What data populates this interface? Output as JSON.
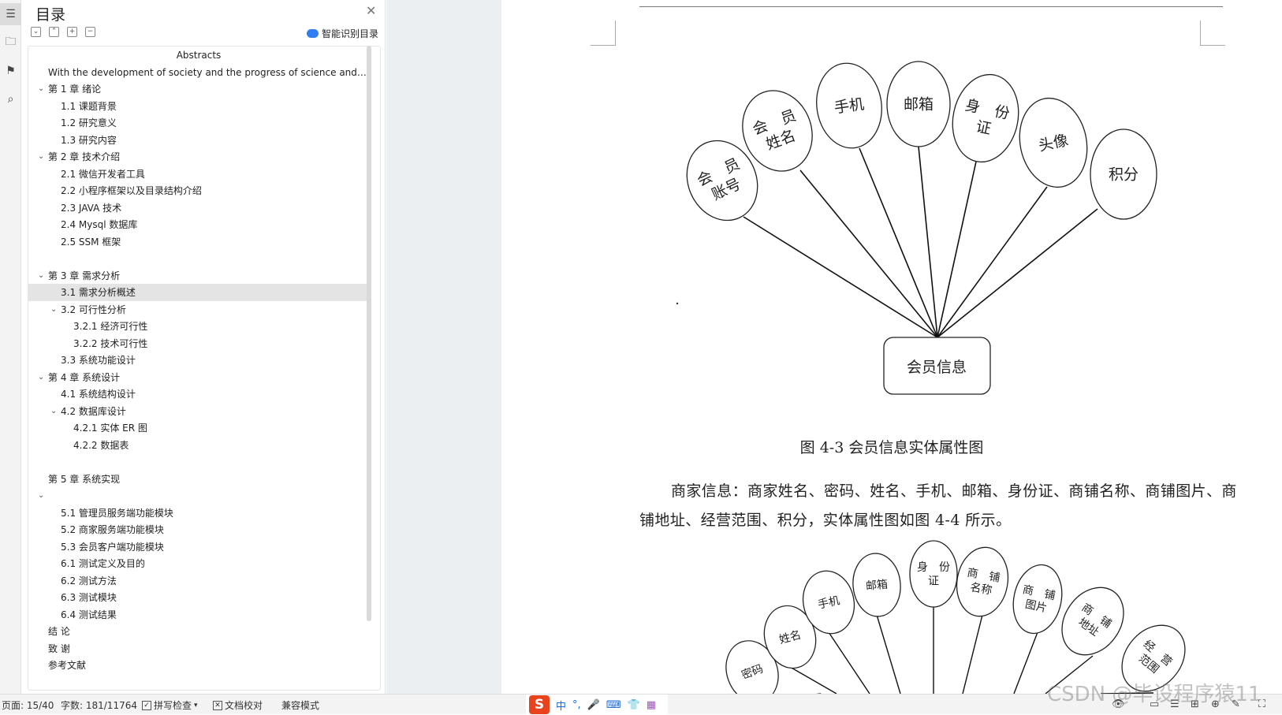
{
  "sidebar_tools": [
    "toc-icon",
    "folder-icon",
    "bookmark-icon",
    "search-icon"
  ],
  "toc": {
    "title": "目录",
    "smart_toc_label": "智能识别目录",
    "items": [
      {
        "label": "Abstracts",
        "level": 0,
        "center": true
      },
      {
        "label": "With the development of society and the progress of science and t...",
        "level": 0
      },
      {
        "label": "第 1 章  绪论",
        "level": 0,
        "chevron": true
      },
      {
        "label": "1.1 课题背景",
        "level": 1
      },
      {
        "label": "1.2 研究意义",
        "level": 1
      },
      {
        "label": "1.3 研究内容",
        "level": 1
      },
      {
        "label": "第 2 章  技术介绍",
        "level": 0,
        "chevron": true
      },
      {
        "label": "2.1 微信开发者工具",
        "level": 1
      },
      {
        "label": "2.2 小程序框架以及目录结构介绍",
        "level": 1
      },
      {
        "label": "2.3 JAVA 技术",
        "level": 1
      },
      {
        "label": "2.4    Mysql 数据库",
        "level": 1
      },
      {
        "label": "2.5 SSM 框架",
        "level": 1
      },
      {
        "label": "",
        "level": 1
      },
      {
        "label": "第 3 章  需求分析",
        "level": 0,
        "chevron": true
      },
      {
        "label": "3.1 需求分析概述",
        "level": 1,
        "selected": true
      },
      {
        "label": "3.2 可行性分析",
        "level": 1,
        "chevron": true
      },
      {
        "label": "3.2.1 经济可行性",
        "level": 2
      },
      {
        "label": "3.2.2 技术可行性",
        "level": 2
      },
      {
        "label": "3.3 系统功能设计",
        "level": 1
      },
      {
        "label": "第 4 章  系统设计",
        "level": 0,
        "chevron": true
      },
      {
        "label": "4.1 系统结构设计",
        "level": 1
      },
      {
        "label": "4.2 数据库设计",
        "level": 1,
        "chevron": true
      },
      {
        "label": "4.2.1 实体 ER 图",
        "level": 2
      },
      {
        "label": "4.2.2 数据表",
        "level": 2
      },
      {
        "label": "",
        "level": 1
      },
      {
        "label": "第 5 章  系统实现",
        "level": 0
      },
      {
        "label": "",
        "level": 0,
        "chevron": true
      },
      {
        "label": "5.1 管理员服务端功能模块",
        "level": 1
      },
      {
        "label": "5.2 商家服务端功能模块",
        "level": 1
      },
      {
        "label": "5.3 会员客户端功能模块",
        "level": 1
      },
      {
        "label": "6.1 测试定义及目的",
        "level": 1
      },
      {
        "label": "6.2 测试方法",
        "level": 1
      },
      {
        "label": "6.3 测试模块",
        "level": 1
      },
      {
        "label": "6.4 测试结果",
        "level": 1
      },
      {
        "label": "结    论",
        "level": 0
      },
      {
        "label": "致    谢",
        "level": 0
      },
      {
        "label": "参考文献",
        "level": 0
      }
    ]
  },
  "document": {
    "figure1": {
      "center_label": "会员信息",
      "attributes": [
        {
          "lines": [
            "会　员",
            "账号"
          ]
        },
        {
          "lines": [
            "会　员",
            "姓名"
          ]
        },
        {
          "lines": [
            "手机"
          ]
        },
        {
          "lines": [
            "邮箱"
          ]
        },
        {
          "lines": [
            "身　份",
            "证"
          ]
        },
        {
          "lines": [
            "头像"
          ]
        },
        {
          "lines": [
            "积分"
          ]
        }
      ]
    },
    "caption": "图 4-3 会员信息实体属性图",
    "paragraph": "商家信息：商家姓名、密码、姓名、手机、邮箱、身份证、商铺名称、商铺图片、商铺地址、经营范围、积分，实体属性图如图 4-4 所示。",
    "figure2": {
      "attributes": [
        {
          "lines": [
            "密码"
          ]
        },
        {
          "lines": [
            "姓名"
          ]
        },
        {
          "lines": [
            "手机"
          ]
        },
        {
          "lines": [
            "邮箱"
          ]
        },
        {
          "lines": [
            "身　份",
            "证"
          ]
        },
        {
          "lines": [
            "商　铺",
            "名称"
          ]
        },
        {
          "lines": [
            "商　铺",
            "图片"
          ]
        },
        {
          "lines": [
            "商　铺",
            "地址"
          ]
        },
        {
          "lines": [
            "经　营",
            "范围"
          ]
        }
      ]
    }
  },
  "statusbar": {
    "page": "页面: 15/40",
    "words": "字数: 181/11764",
    "spellcheck": "拼写检查",
    "proofread": "文档校对",
    "compat": "兼容模式",
    "ime_lang": "中"
  },
  "watermark": "CSDN @毕设程序猿11"
}
